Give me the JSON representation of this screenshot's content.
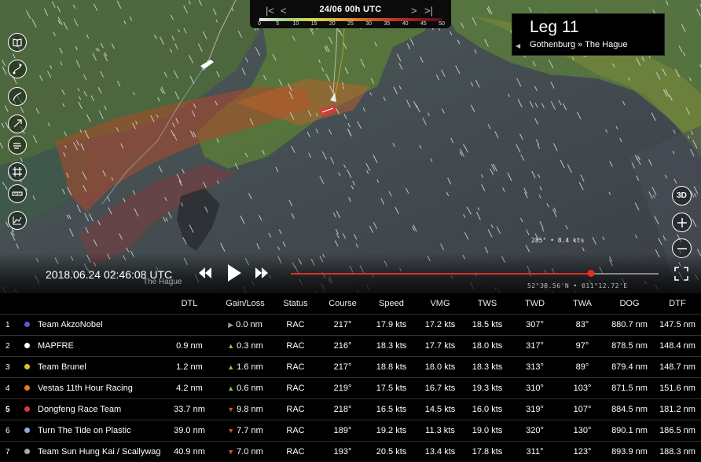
{
  "timebar": {
    "date": "24/06 00h UTC",
    "nav_first": "|<",
    "nav_prev": "<",
    "nav_next": ">",
    "nav_last": ">|",
    "scale_ticks": [
      "0",
      "5",
      "10",
      "15",
      "20",
      "25",
      "30",
      "35",
      "40",
      "45",
      "50"
    ]
  },
  "leg": {
    "title": "Leg 11",
    "route": "Gothenburg » The Hague",
    "collapse_icon": "triangle-left-icon"
  },
  "tools": [
    "book-icon",
    "route-icon",
    "layer-icon",
    "compass-icon",
    "wind-layer-icon",
    "grid-icon",
    "ruler-icon",
    "chart-icon"
  ],
  "right_tools": {
    "view3d_label": "3D",
    "zoom_in": "plus-icon",
    "zoom_out": "minus-icon"
  },
  "playback": {
    "datetime": "2018.06.24 02:46:08 UTC",
    "place_label": "The Hague",
    "progress": 0.816
  },
  "map": {
    "coordinates": "52°38.56'N • 011°12.72'E",
    "wind_readout": "285° • 8.4 kts"
  },
  "colors": {
    "accent": "#e03020",
    "gain": "#7ecf3a",
    "loss": "#e24a2a",
    "neutral": "#999999"
  },
  "leaderboard": {
    "columns": [
      "DTL",
      "Gain/Loss",
      "Status",
      "Course",
      "Speed",
      "VMG",
      "TWS",
      "TWD",
      "TWA",
      "DOG",
      "DTF"
    ],
    "rows": [
      {
        "rank": "1",
        "team": "Team AkzoNobel",
        "color": "#6f4fd1",
        "dtl": "",
        "gain_dir": "flat",
        "gain": "0.0 nm",
        "status": "RAC",
        "course": "217°",
        "speed": "17.9 kts",
        "vmg": "17.2 kts",
        "tws": "18.5 kts",
        "twd": "307°",
        "twa": "83°",
        "dog": "880.7 nm",
        "dtf": "147.5 nm"
      },
      {
        "rank": "2",
        "team": "MAPFRE",
        "color": "#ffffff",
        "dtl": "0.9 nm",
        "gain_dir": "up",
        "gain": "0.3 nm",
        "status": "RAC",
        "course": "216°",
        "speed": "18.3 kts",
        "vmg": "17.7 kts",
        "tws": "18.0 kts",
        "twd": "317°",
        "twa": "97°",
        "dog": "878.5 nm",
        "dtf": "148.4 nm"
      },
      {
        "rank": "3",
        "team": "Team Brunel",
        "color": "#e6c020",
        "dtl": "1.2 nm",
        "gain_dir": "up",
        "gain": "1.6 nm",
        "status": "RAC",
        "course": "217°",
        "speed": "18.8 kts",
        "vmg": "18.0 kts",
        "tws": "18.3 kts",
        "twd": "313°",
        "twa": "89°",
        "dog": "879.4 nm",
        "dtf": "148.7 nm"
      },
      {
        "rank": "4",
        "team": "Vestas 11th Hour Racing",
        "color": "#e07b2a",
        "dtl": "4.2 nm",
        "gain_dir": "up",
        "gain": "0.6 nm",
        "status": "RAC",
        "course": "219°",
        "speed": "17.5 kts",
        "vmg": "16.7 kts",
        "tws": "19.3 kts",
        "twd": "310°",
        "twa": "103°",
        "dog": "871.5 nm",
        "dtf": "151.6 nm"
      },
      {
        "rank": "5",
        "team": "Dongfeng Race Team",
        "color": "#d43c3c",
        "dtl": "33.7 nm",
        "gain_dir": "down",
        "gain": "9.8 nm",
        "status": "RAC",
        "course": "218°",
        "speed": "16.5 kts",
        "vmg": "14.5 kts",
        "tws": "16.0 kts",
        "twd": "319°",
        "twa": "107°",
        "dog": "884.5 nm",
        "dtf": "181.2 nm"
      },
      {
        "rank": "6",
        "team": "Turn The Tide on Plastic",
        "color": "#8fa8e0",
        "dtl": "39.0 nm",
        "gain_dir": "down",
        "gain": "7.7 nm",
        "status": "RAC",
        "course": "189°",
        "speed": "19.2 kts",
        "vmg": "11.3 kts",
        "tws": "19.0 kts",
        "twd": "320°",
        "twa": "130°",
        "dog": "890.1 nm",
        "dtf": "186.5 nm"
      },
      {
        "rank": "7",
        "team": "Team Sun Hung Kai / Scallywag",
        "color": "#aaaaaa",
        "dtl": "40.9 nm",
        "gain_dir": "down",
        "gain": "7.0 nm",
        "status": "RAC",
        "course": "193°",
        "speed": "20.5 kts",
        "vmg": "13.4 kts",
        "tws": "17.8 kts",
        "twd": "311°",
        "twa": "123°",
        "dog": "893.9 nm",
        "dtf": "188.3 nm"
      }
    ]
  }
}
